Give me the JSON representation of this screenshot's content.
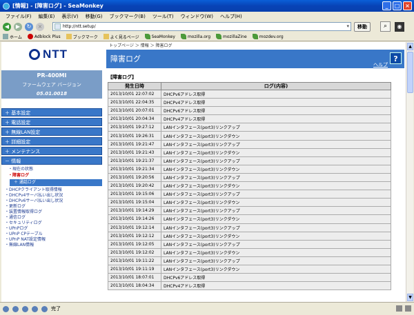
{
  "window": {
    "title": "[情報] - [障害ログ] - SeaMonkey",
    "minimize": "_",
    "maximize": "□",
    "close": "×"
  },
  "menubar": [
    "ファイル(F)",
    "編集(E)",
    "表示(V)",
    "移動(G)",
    "ブックマーク(B)",
    "ツール(T)",
    "ウィンドウ(W)",
    "ヘルプ(H)"
  ],
  "nav": {
    "url": "http://ntt.setup/",
    "go_label": "移動",
    "url_dropdown": "▾"
  },
  "bookmarks": [
    "ホーム",
    "Adblock Plus",
    "ブックマーク",
    "よく見るページ",
    "SeaMonkey",
    "mozilla.org",
    "mozillaZine",
    "mozdev.org"
  ],
  "sidebar": {
    "logo_text": "NTT",
    "model": "PR-400MI",
    "firmware_label": "ファームウェア バージョン",
    "firmware_version": "05.01.0018",
    "categories": [
      "＋ 基本設定",
      "＋ 電話設定",
      "＋ 無線LAN設定",
      "＋ 詳細設定",
      "＋ メンテナンス"
    ],
    "info_category": "－ 情報",
    "info_items": [
      "・現在の状態",
      "・障害ログ"
    ],
    "sub_category": "＋ 通話ログ",
    "links": [
      "・DHCPクライアント取得情報",
      "・DHCPv4サーバ払い出し状況",
      "・DHCPv6サーバ払い出し状況",
      "・更新ログ",
      "・装置情報取得ログ",
      "・通信ログ",
      "・セキュリティログ",
      "・UPnPログ",
      "・UPnP CPテーブル",
      "・UPnP NAT設定情報",
      "・無線LAN情報"
    ]
  },
  "main": {
    "breadcrumb": "トップページ ＞ 情報 ＞ 障害ログ",
    "page_title": "障害ログ",
    "help_label": "ヘルプ",
    "help_icon": "?",
    "section_title": "【障害ログ】",
    "columns": [
      "発生日時",
      "ログ(内容)"
    ],
    "rows": [
      [
        "2013/10/01 22:07:02",
        "DHCPv6アドレス取得"
      ],
      [
        "2013/10/01 22:04:35",
        "DHCPv4アドレス取得"
      ],
      [
        "2013/10/01 20:07:01",
        "DHCPv6アドレス取得"
      ],
      [
        "2013/10/01 20:04:34",
        "DHCPv4アドレス取得"
      ],
      [
        "2013/10/01 19:27:12",
        "LANインタフェース(port3)リンクアップ"
      ],
      [
        "2013/10/01 19:26:31",
        "LANインタフェース(port3)リンクダウン"
      ],
      [
        "2013/10/01 19:21:47",
        "LANインタフェース(port3)リンクアップ"
      ],
      [
        "2013/10/01 19:21:43",
        "LANインタフェース(port3)リンクダウン"
      ],
      [
        "2013/10/01 19:21:37",
        "LANインタフェース(port3)リンクアップ"
      ],
      [
        "2013/10/01 19:21:34",
        "LANインタフェース(port3)リンクダウン"
      ],
      [
        "2013/10/01 19:20:56",
        "LANインタフェース(port3)リンクアップ"
      ],
      [
        "2013/10/01 19:20:42",
        "LANインタフェース(port3)リンクダウン"
      ],
      [
        "2013/10/01 19:15:06",
        "LANインタフェース(port3)リンクアップ"
      ],
      [
        "2013/10/01 19:15:04",
        "LANインタフェース(port3)リンクダウン"
      ],
      [
        "2013/10/01 19:14:29",
        "LANインタフェース(port3)リンクアップ"
      ],
      [
        "2013/10/01 19:14:26",
        "LANインタフェース(port3)リンクダウン"
      ],
      [
        "2013/10/01 19:12:14",
        "LANインタフェース(port3)リンクアップ"
      ],
      [
        "2013/10/01 19:12:12",
        "LANインタフェース(port3)リンクダウン"
      ],
      [
        "2013/10/01 19:12:05",
        "LANインタフェース(port3)リンクアップ"
      ],
      [
        "2013/10/01 19:12:02",
        "LANインタフェース(port3)リンクダウン"
      ],
      [
        "2013/10/01 19:11:22",
        "LANインタフェース(port3)リンクアップ"
      ],
      [
        "2013/10/01 19:11:19",
        "LANインタフェース(port3)リンクダウン"
      ],
      [
        "2013/10/01 18:07:01",
        "DHCPv6アドレス取得"
      ],
      [
        "2013/10/01 18:04:34",
        "DHCPv4アドレス取得"
      ]
    ]
  },
  "statusbar": {
    "text": "完了"
  }
}
